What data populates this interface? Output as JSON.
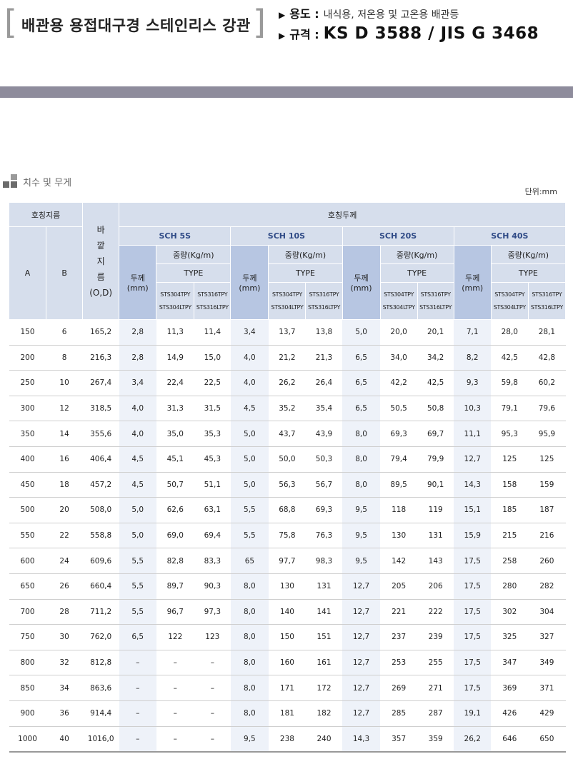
{
  "header": {
    "title": "배관용 용접대구경 스테인리스 강관",
    "usage_label": "용도 :",
    "usage_value": "내식용, 저온용 및 고온용 배관등",
    "standard_label": "규격 :",
    "standard_value": "KS D 3588 / JIS G 3468"
  },
  "section": {
    "label": "치수 및 무게",
    "unit": "단위:mm"
  },
  "table": {
    "nominal_size": "호칭지름",
    "col_a": "A",
    "col_b": "B",
    "od_chars": [
      "바",
      "깥",
      "지",
      "름"
    ],
    "od_abbr": "(O,D)",
    "nominal_thickness": "호칭두께",
    "thickness_label": "두께",
    "thickness_unit": "(mm)",
    "weight_label": "중량(Kg/m)",
    "type_label": "TYPE",
    "type_a1": "STS304TPY",
    "type_a2": "STS304LTPY",
    "type_b1": "STS316TPY",
    "type_b2": "STS316LTPY",
    "schedules": [
      "SCH 5S",
      "SCH 10S",
      "SCH 20S",
      "SCH 40S"
    ],
    "rows": [
      [
        "150",
        "6",
        "165,2",
        "2,8",
        "11,3",
        "11,4",
        "3,4",
        "13,7",
        "13,8",
        "5,0",
        "20,0",
        "20,1",
        "7,1",
        "28,0",
        "28,1"
      ],
      [
        "200",
        "8",
        "216,3",
        "2,8",
        "14,9",
        "15,0",
        "4,0",
        "21,2",
        "21,3",
        "6,5",
        "34,0",
        "34,2",
        "8,2",
        "42,5",
        "42,8"
      ],
      [
        "250",
        "10",
        "267,4",
        "3,4",
        "22,4",
        "22,5",
        "4,0",
        "26,2",
        "26,4",
        "6,5",
        "42,2",
        "42,5",
        "9,3",
        "59,8",
        "60,2"
      ],
      [
        "300",
        "12",
        "318,5",
        "4,0",
        "31,3",
        "31,5",
        "4,5",
        "35,2",
        "35,4",
        "6,5",
        "50,5",
        "50,8",
        "10,3",
        "79,1",
        "79,6"
      ],
      [
        "350",
        "14",
        "355,6",
        "4,0",
        "35,0",
        "35,3",
        "5,0",
        "43,7",
        "43,9",
        "8,0",
        "69,3",
        "69,7",
        "11,1",
        "95,3",
        "95,9"
      ],
      [
        "400",
        "16",
        "406,4",
        "4,5",
        "45,1",
        "45,3",
        "5,0",
        "50,0",
        "50,3",
        "8,0",
        "79,4",
        "79,9",
        "12,7",
        "125",
        "125"
      ],
      [
        "450",
        "18",
        "457,2",
        "4,5",
        "50,7",
        "51,1",
        "5,0",
        "56,3",
        "56,7",
        "8,0",
        "89,5",
        "90,1",
        "14,3",
        "158",
        "159"
      ],
      [
        "500",
        "20",
        "508,0",
        "5,0",
        "62,6",
        "63,1",
        "5,5",
        "68,8",
        "69,3",
        "9,5",
        "118",
        "119",
        "15,1",
        "185",
        "187"
      ],
      [
        "550",
        "22",
        "558,8",
        "5,0",
        "69,0",
        "69,4",
        "5,5",
        "75,8",
        "76,3",
        "9,5",
        "130",
        "131",
        "15,9",
        "215",
        "216"
      ],
      [
        "600",
        "24",
        "609,6",
        "5,5",
        "82,8",
        "83,3",
        "65",
        "97,7",
        "98,3",
        "9,5",
        "142",
        "143",
        "17,5",
        "258",
        "260"
      ],
      [
        "650",
        "26",
        "660,4",
        "5,5",
        "89,7",
        "90,3",
        "8,0",
        "130",
        "131",
        "12,7",
        "205",
        "206",
        "17,5",
        "280",
        "282"
      ],
      [
        "700",
        "28",
        "711,2",
        "5,5",
        "96,7",
        "97,3",
        "8,0",
        "140",
        "141",
        "12,7",
        "221",
        "222",
        "17,5",
        "302",
        "304"
      ],
      [
        "750",
        "30",
        "762,0",
        "6,5",
        "122",
        "123",
        "8,0",
        "150",
        "151",
        "12,7",
        "237",
        "239",
        "17,5",
        "325",
        "327"
      ],
      [
        "800",
        "32",
        "812,8",
        "–",
        "–",
        "–",
        "8,0",
        "160",
        "161",
        "12,7",
        "253",
        "255",
        "17,5",
        "347",
        "349"
      ],
      [
        "850",
        "34",
        "863,6",
        "–",
        "–",
        "–",
        "8,0",
        "171",
        "172",
        "12,7",
        "269",
        "271",
        "17,5",
        "369",
        "371"
      ],
      [
        "900",
        "36",
        "914,4",
        "–",
        "–",
        "–",
        "8,0",
        "181",
        "182",
        "12,7",
        "285",
        "287",
        "19,1",
        "426",
        "429"
      ],
      [
        "1000",
        "40",
        "1016,0",
        "–",
        "–",
        "–",
        "9,5",
        "238",
        "240",
        "14,3",
        "357",
        "359",
        "26,2",
        "646",
        "650"
      ]
    ]
  }
}
